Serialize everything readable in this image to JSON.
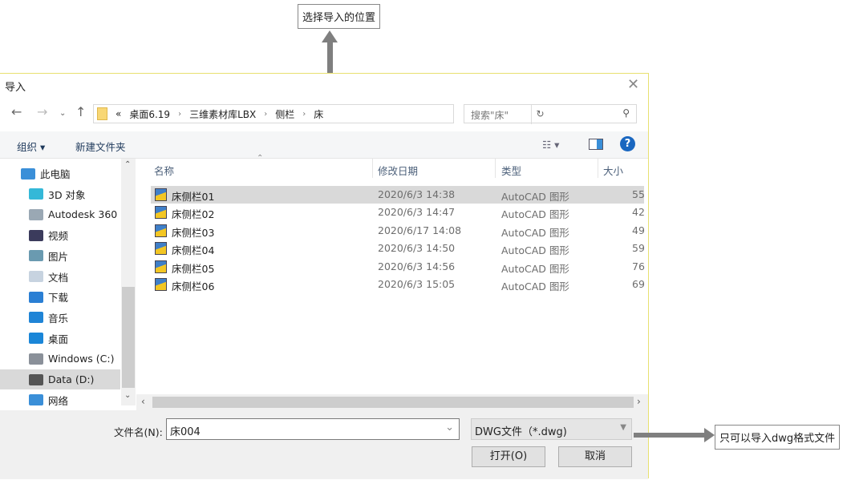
{
  "annotations": {
    "top": "选择导入的位置",
    "right": "只可以导入dwg格式文件"
  },
  "dialog": {
    "title": "导入",
    "address": {
      "overflow": "«",
      "crumbs": [
        "桌面6.19",
        "三维素材库LBX",
        "侧栏",
        "床"
      ]
    },
    "search_placeholder": "搜索\"床\"",
    "toolbar": {
      "organize": "组织 ▾",
      "new_folder": "新建文件夹"
    },
    "sidebar": [
      {
        "label": "此电脑",
        "icon": "computer-icon",
        "color": "#3a8fd8"
      },
      {
        "label": "3D 对象",
        "icon": "cube-icon",
        "color": "#34b8d8"
      },
      {
        "label": "Autodesk 360",
        "icon": "cloud-icon",
        "color": "#9aa8b4"
      },
      {
        "label": "视频",
        "icon": "film-icon",
        "color": "#3b3b5c"
      },
      {
        "label": "图片",
        "icon": "picture-icon",
        "color": "#6a9ab0"
      },
      {
        "label": "文档",
        "icon": "document-icon",
        "color": "#c7d3e0"
      },
      {
        "label": "下载",
        "icon": "download-icon",
        "color": "#2a7fd4"
      },
      {
        "label": "音乐",
        "icon": "music-icon",
        "color": "#1f84d6"
      },
      {
        "label": "桌面",
        "icon": "desktop-icon",
        "color": "#1a86d8"
      },
      {
        "label": "Windows (C:)",
        "icon": "drive-icon",
        "color": "#8a9099"
      },
      {
        "label": "Data (D:)",
        "icon": "drive-icon",
        "color": "#555"
      },
      {
        "label": "网络",
        "icon": "network-icon",
        "color": "#3a8fd8"
      }
    ],
    "columns": [
      "名称",
      "修改日期",
      "类型",
      "大小"
    ],
    "files": [
      {
        "name": "床侧栏01",
        "date": "2020/6/3 14:38",
        "type": "AutoCAD 图形",
        "size": "55"
      },
      {
        "name": "床侧栏02",
        "date": "2020/6/3 14:47",
        "type": "AutoCAD 图形",
        "size": "42"
      },
      {
        "name": "床侧栏03",
        "date": "2020/6/17 14:08",
        "type": "AutoCAD 图形",
        "size": "49"
      },
      {
        "name": "床侧栏04",
        "date": "2020/6/3 14:50",
        "type": "AutoCAD 图形",
        "size": "59"
      },
      {
        "name": "床侧栏05",
        "date": "2020/6/3 14:56",
        "type": "AutoCAD 图形",
        "size": "76"
      },
      {
        "name": "床侧栏06",
        "date": "2020/6/3 15:05",
        "type": "AutoCAD 图形",
        "size": "69"
      }
    ],
    "filename_label": "文件名(N):",
    "filename_value": "床004",
    "filetype": "DWG文件（*.dwg)",
    "open": "打开(O)",
    "cancel": "取消"
  }
}
